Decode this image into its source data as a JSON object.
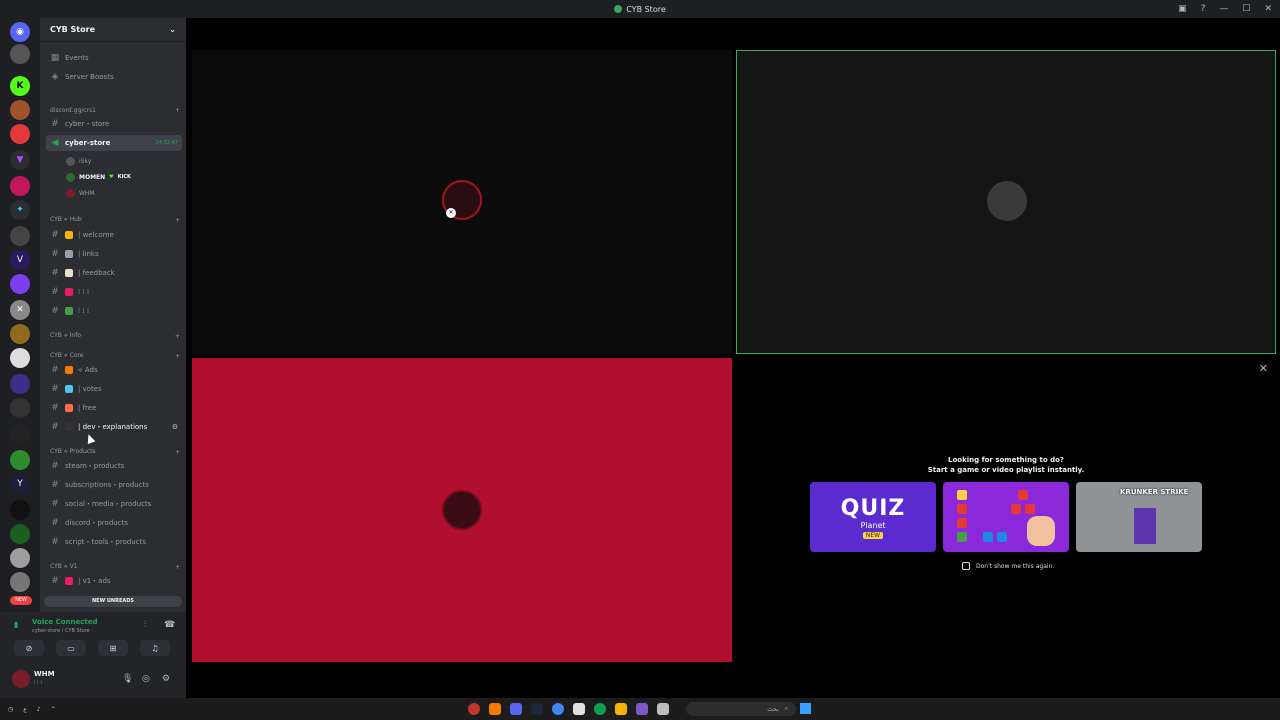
{
  "window": {
    "title": "CYB Store"
  },
  "guild": {
    "name": "CYB Store"
  },
  "menu": {
    "events": "Events",
    "server_boosts": "Server Boosts"
  },
  "categories": {
    "invite": "discord.gg/crs1",
    "hub": "CYB ⟡ Hub",
    "info": "CYB ⟡ Info",
    "core": "CYB ⟡ Core",
    "products": "CYB ⟡ Products",
    "v1": "CYB ⟡ V1"
  },
  "channels": {
    "cyber_store_text": "cyber・store",
    "voice": {
      "name": "cyber-store",
      "timer": "24:52:47"
    },
    "voice_users": [
      "iSky",
      "MOMEN",
      "WHM"
    ],
    "momen_tag": "KICK",
    "hub": [
      "| welcome",
      "| links",
      "| feedback",
      "⁞ ⁞ ⁞",
      "⁞ ⁞ ⁞"
    ],
    "core": [
      "⟡ Ads",
      "| votes",
      "| free",
      "| dev・explanations"
    ],
    "products": [
      "steam・products",
      "subscriptions・products",
      "social・media・products",
      "discord・products",
      "script・tools・products"
    ],
    "v1": [
      "| v1・ads"
    ]
  },
  "new_unreads": "NEW UNREADS",
  "rail_new": "NEW",
  "voice_panel": {
    "status": "Voice Connected",
    "location": "cyber-store / CYB Store"
  },
  "user": {
    "name": "WHM",
    "status": "⁞ ⁞ ⁞"
  },
  "activity": {
    "line1": "Looking for something to do?",
    "line2": "Start a game or video playlist instantly.",
    "quiz_title": "QUIZ",
    "quiz_sub": "Planet",
    "quiz_new": "NEW",
    "krunker": "KRUNKER STRIKE",
    "dont_show": "Don't show me this again."
  },
  "taskbar": {
    "search": "بحث"
  },
  "colors": {
    "accent_green": "#3ba55d",
    "tile_red": "#b10f2e",
    "bg_dark": "#2b2d31"
  }
}
